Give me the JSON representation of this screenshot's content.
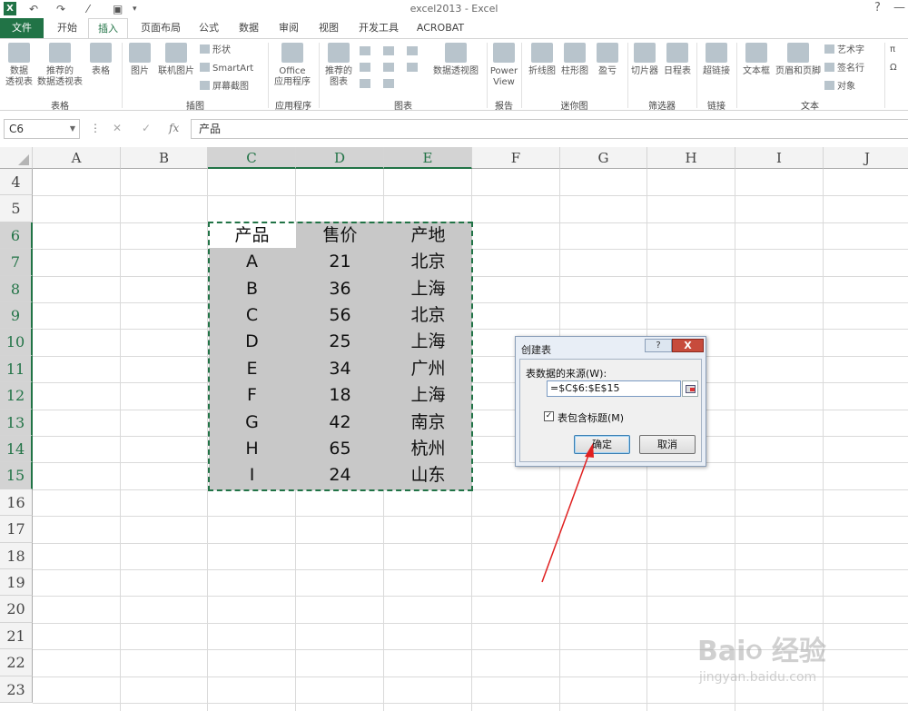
{
  "titlebar": {
    "title": "excel2013 - Excel",
    "help": "?",
    "minimize": "—"
  },
  "tabs": [
    "文件",
    "开始",
    "插入",
    "页面布局",
    "公式",
    "数据",
    "审阅",
    "视图",
    "开发工具",
    "ACROBAT"
  ],
  "ribbon": {
    "pivot": [
      "数据",
      "透视表"
    ],
    "rec_pivot": [
      "推荐的",
      "数据透视表"
    ],
    "table": "表格",
    "picture": "图片",
    "online_pic": "联机图片",
    "shapes": "形状",
    "smartart": "SmartArt",
    "screenshot": "屏幕截图",
    "office_apps": [
      "Office",
      "应用程序"
    ],
    "rec_charts": [
      "推荐的",
      "图表"
    ],
    "pivot_chart": "数据透视图",
    "power_view": [
      "Power",
      "View"
    ],
    "line": "折线图",
    "column": "柱形图",
    "winloss": "盈亏",
    "slicer": "切片器",
    "timeline": "日程表",
    "hyperlink": "超链接",
    "textbox": "文本框",
    "header_footer": "页眉和页脚",
    "wordart": "艺术字",
    "signature": "签名行",
    "object": "对象",
    "groups": {
      "tables": "表格",
      "illustrations": "插图",
      "apps": "应用程序",
      "charts": "图表",
      "reports": "报告",
      "sparklines": "迷你图",
      "filters": "筛选器",
      "links": "链接",
      "text": "文本"
    }
  },
  "formula_bar": {
    "name_box": "C6",
    "fx": "fx",
    "content": "产品"
  },
  "columns": [
    "A",
    "B",
    "C",
    "D",
    "E",
    "F",
    "G",
    "H",
    "I",
    "J"
  ],
  "rows": [
    "4",
    "5",
    "6",
    "7",
    "8",
    "9",
    "10",
    "11",
    "12",
    "13",
    "14",
    "15",
    "16",
    "17",
    "18",
    "19",
    "20",
    "21",
    "22",
    "23"
  ],
  "table": {
    "headers": [
      "产品",
      "售价",
      "产地"
    ],
    "rows": [
      [
        "A",
        "21",
        "北京"
      ],
      [
        "B",
        "36",
        "上海"
      ],
      [
        "C",
        "56",
        "北京"
      ],
      [
        "D",
        "25",
        "上海"
      ],
      [
        "E",
        "34",
        "广州"
      ],
      [
        "F",
        "18",
        "上海"
      ],
      [
        "G",
        "42",
        "南京"
      ],
      [
        "H",
        "65",
        "杭州"
      ],
      [
        "I",
        "24",
        "山东"
      ]
    ]
  },
  "dialog": {
    "title": "创建表",
    "help": "?",
    "close": "X",
    "source_label": "表数据的来源(W):",
    "range": "=$C$6:$E$15",
    "has_headers_label": "表包含标题(M)",
    "has_headers_checked": true,
    "check_mark": "✓",
    "ok": "确定",
    "cancel": "取消"
  },
  "watermark": {
    "brand": "Bai૦ 经验",
    "url": "jingyan.baidu.com"
  },
  "colors": {
    "excel_green": "#217346",
    "arrow": "#e02020",
    "selected_fill": "#c8c8c8"
  }
}
